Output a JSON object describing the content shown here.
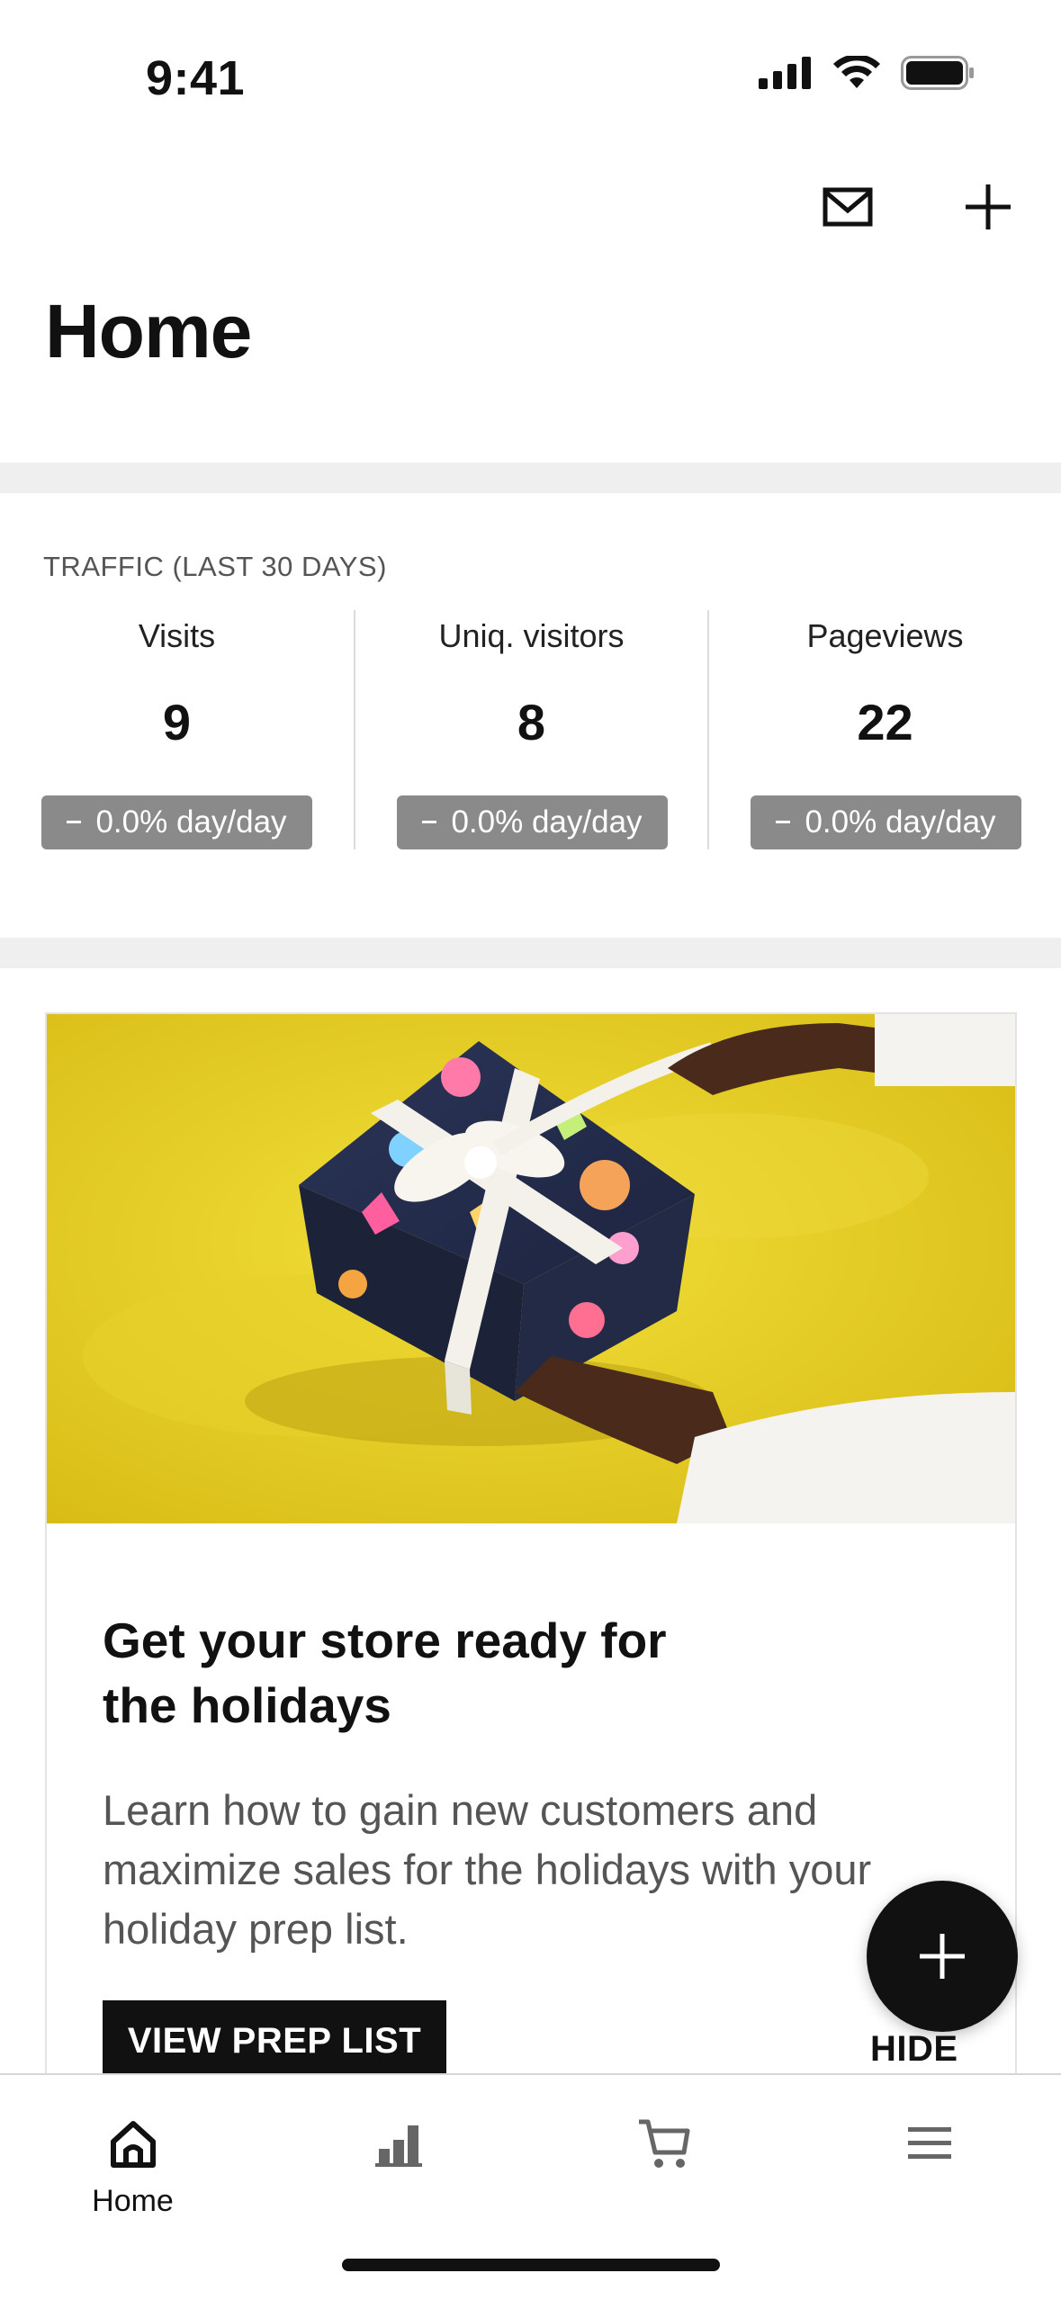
{
  "status_bar": {
    "time": "9:41"
  },
  "header": {
    "title": "Home"
  },
  "traffic": {
    "label": "TRAFFIC  (LAST 30 DAYS)",
    "metrics": [
      {
        "label": "Visits",
        "value": "9",
        "change": "0.0% day/day"
      },
      {
        "label": "Uniq. visitors",
        "value": "8",
        "change": "0.0% day/day"
      },
      {
        "label": "Pageviews",
        "value": "22",
        "change": "0.0% day/day"
      }
    ]
  },
  "promo": {
    "title": "Get your store ready for the holidays",
    "description": "Learn how to gain new customers and maximize sales for the holidays with your holiday prep list.",
    "cta_label": "VIEW PREP LIST",
    "hide_label": "HIDE"
  },
  "tab_bar": {
    "items": [
      {
        "label": "Home",
        "icon": "home-icon",
        "active": true
      },
      {
        "label": "",
        "icon": "analytics-icon",
        "active": false
      },
      {
        "label": "",
        "icon": "cart-icon",
        "active": false
      },
      {
        "label": "",
        "icon": "menu-icon",
        "active": false
      }
    ]
  },
  "colors": {
    "badge": "#8a8a8a",
    "primary": "#111111",
    "divider": "#efefef",
    "promo_background": "#e8cf2a"
  }
}
